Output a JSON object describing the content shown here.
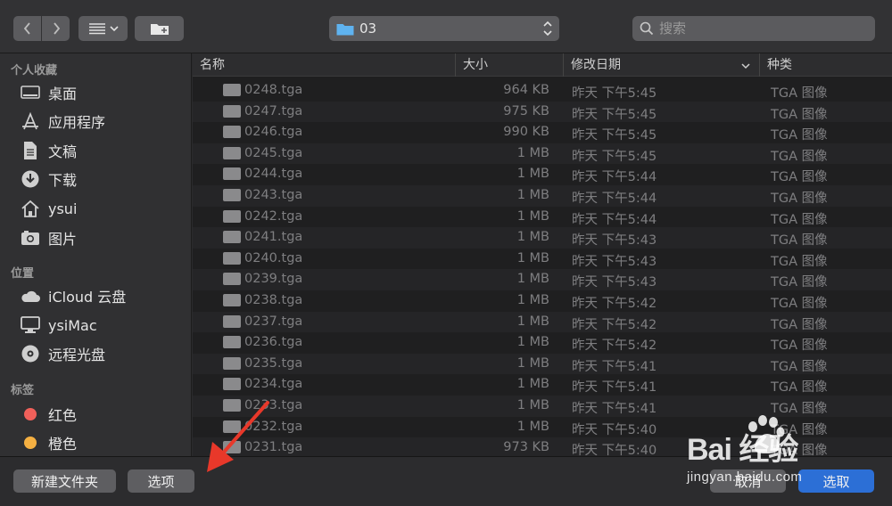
{
  "toolbar": {
    "path_label": "03",
    "search_placeholder": "搜索"
  },
  "sidebar": {
    "sections": [
      {
        "title": "个人收藏",
        "items": [
          {
            "label": "桌面",
            "icon": "desktop-icon"
          },
          {
            "label": "应用程序",
            "icon": "applications-icon"
          },
          {
            "label": "文稿",
            "icon": "documents-icon"
          },
          {
            "label": "下载",
            "icon": "downloads-icon"
          },
          {
            "label": "ysui",
            "icon": "home-icon"
          },
          {
            "label": "图片",
            "icon": "pictures-icon"
          }
        ]
      },
      {
        "title": "位置",
        "items": [
          {
            "label": "iCloud 云盘",
            "icon": "icloud-icon"
          },
          {
            "label": "ysiMac",
            "icon": "computer-icon"
          },
          {
            "label": "远程光盘",
            "icon": "disc-icon"
          }
        ]
      },
      {
        "title": "标签",
        "items": [
          {
            "label": "红色",
            "icon": "tag-red-icon",
            "color": "#f0605a"
          },
          {
            "label": "橙色",
            "icon": "tag-orange-icon",
            "color": "#f5b042"
          }
        ]
      }
    ]
  },
  "columns": {
    "name": "名称",
    "size": "大小",
    "date": "修改日期",
    "kind": "种类"
  },
  "files": [
    {
      "name": "0248.tga",
      "size": "964 KB",
      "date": "昨天 下午5:45",
      "kind": "TGA 图像"
    },
    {
      "name": "0247.tga",
      "size": "975 KB",
      "date": "昨天 下午5:45",
      "kind": "TGA 图像"
    },
    {
      "name": "0246.tga",
      "size": "990 KB",
      "date": "昨天 下午5:45",
      "kind": "TGA 图像"
    },
    {
      "name": "0245.tga",
      "size": "1 MB",
      "date": "昨天 下午5:45",
      "kind": "TGA 图像"
    },
    {
      "name": "0244.tga",
      "size": "1 MB",
      "date": "昨天 下午5:44",
      "kind": "TGA 图像"
    },
    {
      "name": "0243.tga",
      "size": "1 MB",
      "date": "昨天 下午5:44",
      "kind": "TGA 图像"
    },
    {
      "name": "0242.tga",
      "size": "1 MB",
      "date": "昨天 下午5:44",
      "kind": "TGA 图像"
    },
    {
      "name": "0241.tga",
      "size": "1 MB",
      "date": "昨天 下午5:43",
      "kind": "TGA 图像"
    },
    {
      "name": "0240.tga",
      "size": "1 MB",
      "date": "昨天 下午5:43",
      "kind": "TGA 图像"
    },
    {
      "name": "0239.tga",
      "size": "1 MB",
      "date": "昨天 下午5:43",
      "kind": "TGA 图像"
    },
    {
      "name": "0238.tga",
      "size": "1 MB",
      "date": "昨天 下午5:42",
      "kind": "TGA 图像"
    },
    {
      "name": "0237.tga",
      "size": "1 MB",
      "date": "昨天 下午5:42",
      "kind": "TGA 图像"
    },
    {
      "name": "0236.tga",
      "size": "1 MB",
      "date": "昨天 下午5:42",
      "kind": "TGA 图像"
    },
    {
      "name": "0235.tga",
      "size": "1 MB",
      "date": "昨天 下午5:41",
      "kind": "TGA 图像"
    },
    {
      "name": "0234.tga",
      "size": "1 MB",
      "date": "昨天 下午5:41",
      "kind": "TGA 图像"
    },
    {
      "name": "0233.tga",
      "size": "1 MB",
      "date": "昨天 下午5:41",
      "kind": "TGA 图像"
    },
    {
      "name": "0232.tga",
      "size": "1 MB",
      "date": "昨天 下午5:40",
      "kind": "TGA 图像"
    },
    {
      "name": "0231.tga",
      "size": "973 KB",
      "date": "昨天 下午5:40",
      "kind": "TGA 图像"
    }
  ],
  "buttons": {
    "new_folder": "新建文件夹",
    "options": "选项",
    "cancel": "取消",
    "choose": "选取"
  },
  "watermark": {
    "brand": "Bai 经验",
    "url": "jingyan.baidu.com"
  },
  "colors": {
    "accent": "#2c6fd6",
    "annotation_arrow": "#e8382a"
  }
}
